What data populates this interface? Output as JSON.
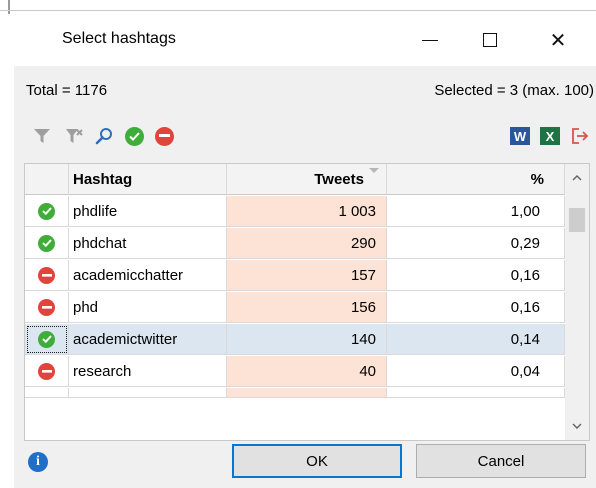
{
  "window": {
    "title": "Select hashtags",
    "controls": {
      "minimize": "minimize-icon",
      "maximize": "maximize-icon",
      "close": "close-icon"
    }
  },
  "summary": {
    "total": "Total = 1176",
    "selected": "Selected = 3 (max. 100)"
  },
  "toolbar": {
    "left_icons": [
      "filter-icon",
      "clear-filter-icon",
      "search-icon",
      "select-all-icon",
      "deselect-all-icon"
    ],
    "right_icons": [
      "word-export-icon",
      "excel-export-icon",
      "exit-icon"
    ]
  },
  "table": {
    "columns": [
      "",
      "Hashtag",
      "Tweets",
      "%"
    ],
    "sort_column": "Tweets",
    "rows": [
      {
        "status": "selected",
        "hashtag": "phdlife",
        "tweets": "1 003",
        "pct": "1,00"
      },
      {
        "status": "selected",
        "hashtag": "phdchat",
        "tweets": "290",
        "pct": "0,29"
      },
      {
        "status": "excluded",
        "hashtag": "academicchatter",
        "tweets": "157",
        "pct": "0,16"
      },
      {
        "status": "excluded",
        "hashtag": "phd",
        "tweets": "156",
        "pct": "0,16"
      },
      {
        "status": "selected",
        "hashtag": "academictwitter",
        "tweets": "140",
        "pct": "0,14"
      },
      {
        "status": "excluded",
        "hashtag": "research",
        "tweets": "40",
        "pct": "0,04"
      }
    ]
  },
  "footer": {
    "ok_label": "OK",
    "cancel_label": "Cancel"
  },
  "colors": {
    "ok_green": "#3fad3a",
    "stop_red": "#e0443c",
    "tweets_fill": "#fde3d5",
    "selection": "#dce6f1",
    "accent_blue": "#0078d7"
  }
}
